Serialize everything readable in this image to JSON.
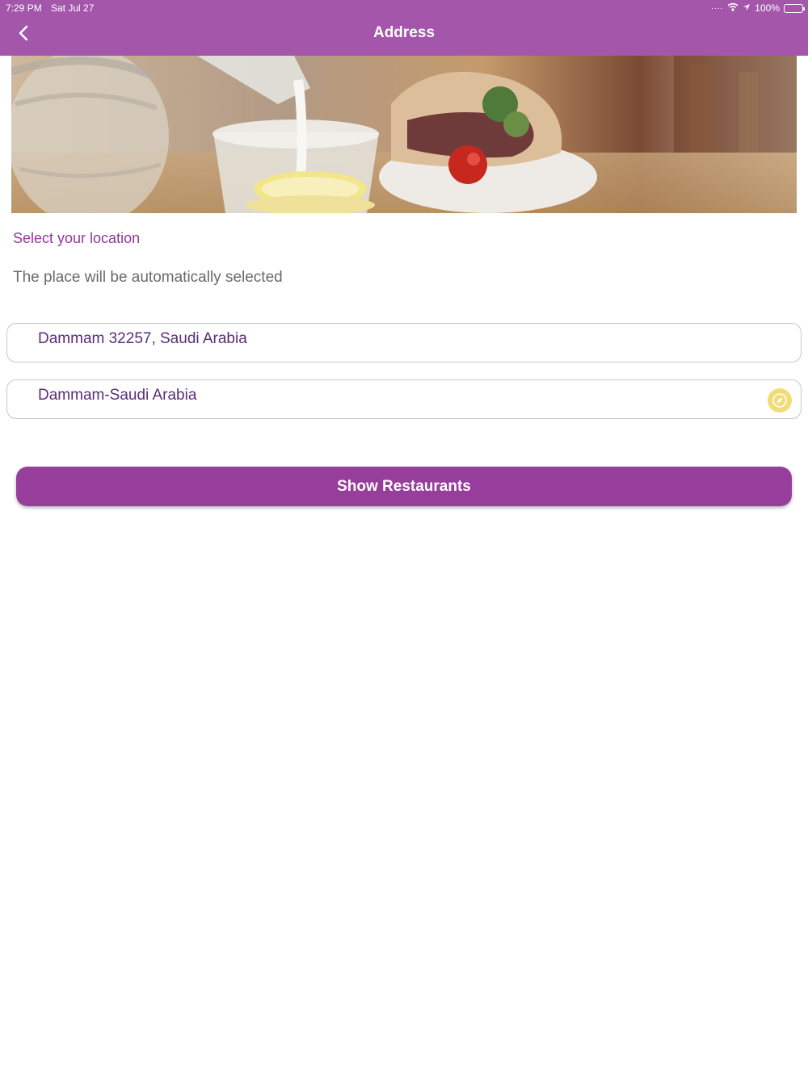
{
  "status_bar": {
    "time": "7:29 PM",
    "date": "Sat Jul 27",
    "signal": "....",
    "battery": "100%"
  },
  "nav": {
    "title": "Address"
  },
  "content": {
    "section_title": "Select your location",
    "section_subtitle": "The place will be automatically selected",
    "address_field": "Dammam 32257, Saudi Arabia",
    "city_field": "Dammam-Saudi Arabia",
    "show_button": "Show Restaurants"
  },
  "colors": {
    "header": "#a456aa",
    "accent": "#973d9b",
    "field_text": "#5a2d78",
    "locate_icon": "#f2dc78"
  },
  "icons": {
    "back": "chevron-left-icon",
    "wifi": "wifi-icon",
    "location": "location-arrow-icon",
    "battery": "battery-icon",
    "locate": "compass-icon"
  }
}
